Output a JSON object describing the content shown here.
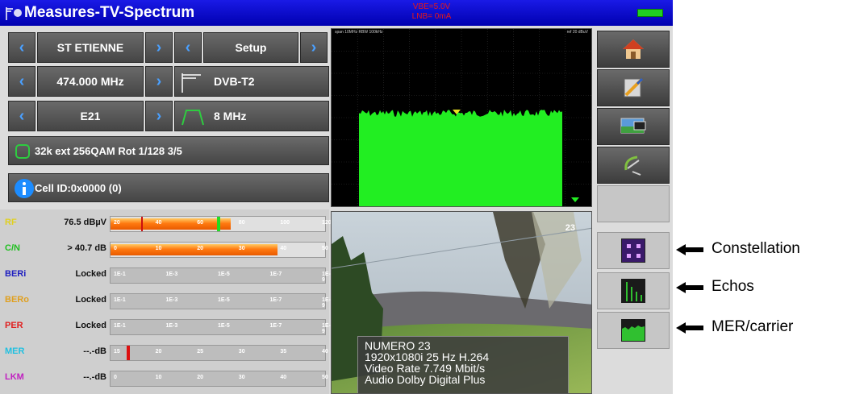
{
  "titlebar": {
    "title": "Measures-TV-Spectrum",
    "status_line1": "VBE=5.0V",
    "status_line2": "LNB= 0mA"
  },
  "controls": {
    "site": "ST ETIENNE",
    "setup": "Setup",
    "frequency": "474.000 MHz",
    "standard": "DVB-T2",
    "channel": "E21",
    "bandwidth": "8 MHz",
    "modulation": "32k ext 256QAM Rot 1/128 3/5",
    "cell_id": "Cell ID:0x0000 (0)"
  },
  "spectrum": {
    "label_left": "span 10MHz  RBW 100kHz",
    "label_right": "ref 20 dBuV",
    "trace_color": "#22ee22"
  },
  "meters": [
    {
      "name": "RF",
      "value": "76.5 dBµV",
      "name_color": "#e0d020",
      "fill": 0.56,
      "ticks": [
        "20",
        "40",
        "60",
        "80",
        "100",
        "120"
      ]
    },
    {
      "name": "C/N",
      "value": "> 40.7 dB",
      "name_color": "#20c020",
      "fill": 0.78,
      "ticks": [
        "0",
        "10",
        "20",
        "30",
        "40",
        "50"
      ]
    },
    {
      "name": "BERi",
      "value": "Locked",
      "name_color": "#2020c0",
      "fill": 0,
      "ticks": [
        "1E-1",
        "1E-3",
        "1E-5",
        "1E-7",
        "1E-9"
      ]
    },
    {
      "name": "BERo",
      "value": "Locked",
      "name_color": "#e0a020",
      "fill": 0,
      "ticks": [
        "1E-1",
        "1E-3",
        "1E-5",
        "1E-7",
        "1E-9"
      ]
    },
    {
      "name": "PER",
      "value": "Locked",
      "name_color": "#e02020",
      "fill": 0,
      "ticks": [
        "1E-1",
        "1E-3",
        "1E-5",
        "1E-7",
        "1E-9"
      ]
    },
    {
      "name": "MER",
      "value": "--.-dB",
      "name_color": "#20c0e0",
      "fill": 0,
      "ticks": [
        "15",
        "20",
        "25",
        "30",
        "35",
        "40"
      ]
    },
    {
      "name": "LKM",
      "value": "--.-dB",
      "name_color": "#c020c0",
      "fill": 0,
      "ticks": [
        "0",
        "10",
        "20",
        "30",
        "40",
        "50"
      ]
    }
  ],
  "video": {
    "channel_number": "23",
    "info": [
      "NUMERO 23",
      "1920x1080i 25 Hz H.264",
      "Video Rate 7.749 Mbit/s",
      "Audio Dolby Digital Plus"
    ]
  },
  "toolbar": {
    "icons": [
      "home-icon",
      "settings-icon",
      "screenshot-icon",
      "satellite-dish-icon"
    ]
  },
  "annotations": [
    "Constellation",
    "Echos",
    "MER/carrier"
  ]
}
